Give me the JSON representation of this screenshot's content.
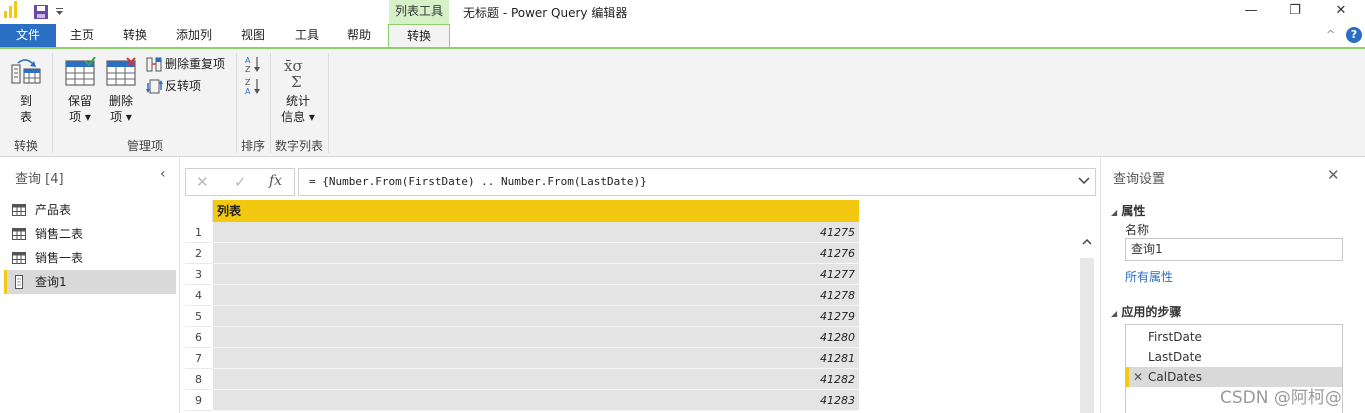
{
  "titlebar": {
    "context_tab": "列表工具",
    "window_title": "无标题 - Power Query 编辑器",
    "minimize": "—",
    "restore": "❐",
    "close": "✕"
  },
  "tabs": {
    "file": "文件",
    "home": "主页",
    "transform": "转换",
    "add_column": "添加列",
    "view": "视图",
    "tools": "工具",
    "help": "帮助",
    "transform_ctx": "转换"
  },
  "ribbon": {
    "to_table_line1": "到",
    "to_table_line2": "表",
    "keep_line1": "保留",
    "keep_line2": "项",
    "remove_line1": "删除",
    "remove_line2": "项",
    "remove_duplicates": "删除重复项",
    "reverse_items": "反转项",
    "stats_line1": "统计",
    "stats_line2": "信息",
    "group_convert": "转换",
    "group_manage": "管理项",
    "group_sort": "排序",
    "group_numeric": "数字列表",
    "help_icon": "?",
    "collapse_icon": "^"
  },
  "queries": {
    "title": "查询 [4]",
    "items": [
      {
        "label": "产品表"
      },
      {
        "label": "销售二表"
      },
      {
        "label": "销售一表"
      },
      {
        "label": "查询1"
      }
    ]
  },
  "formula": {
    "cancel": "✕",
    "confirm": "✓",
    "fx": "fx",
    "text": "= {Number.From(FirstDate) .. Number.From(LastDate)}"
  },
  "grid": {
    "column_header": "列表",
    "rows": [
      {
        "n": "1",
        "v": "41275"
      },
      {
        "n": "2",
        "v": "41276"
      },
      {
        "n": "3",
        "v": "41277"
      },
      {
        "n": "4",
        "v": "41278"
      },
      {
        "n": "5",
        "v": "41279"
      },
      {
        "n": "6",
        "v": "41280"
      },
      {
        "n": "7",
        "v": "41281"
      },
      {
        "n": "8",
        "v": "41282"
      },
      {
        "n": "9",
        "v": "41283"
      }
    ]
  },
  "settings": {
    "title": "查询设置",
    "properties": "属性",
    "name_label": "名称",
    "name_value": "查询1",
    "all_properties": "所有属性",
    "applied_steps": "应用的步骤",
    "steps": [
      {
        "label": "FirstDate"
      },
      {
        "label": "LastDate"
      },
      {
        "label": "CalDates"
      }
    ]
  },
  "watermark": "CSDN @阿柯@",
  "colors": {
    "accent_blue": "#2b6fc4",
    "header_yellow": "#f2c811",
    "context_green": "#8ed06e"
  }
}
